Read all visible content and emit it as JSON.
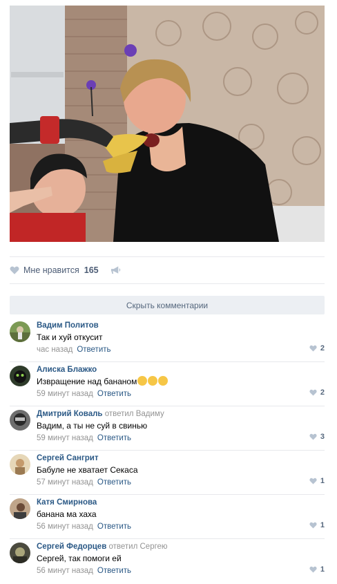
{
  "post": {
    "likes_label": "Мне нравится",
    "likes_count": "165"
  },
  "comments_toggle": "Скрыть комментарии",
  "comments": [
    {
      "author": "Вадим Политов",
      "reply_prefix": "",
      "reply_to": "",
      "text": "Так и хуй откусит",
      "time": "час назад",
      "reply_label": "Ответить",
      "likes": "2",
      "emojis": 0
    },
    {
      "author": "Алиска Блажко",
      "reply_prefix": "",
      "reply_to": "",
      "text": "Извращение над бананом",
      "time": "59 минут назад",
      "reply_label": "Ответить",
      "likes": "2",
      "emojis": 3
    },
    {
      "author": "Дмитрий Коваль",
      "reply_prefix": "ответил",
      "reply_to": "Вадиму",
      "text": "Вадим, а ты не суй в свинью",
      "time": "59 минут назад",
      "reply_label": "Ответить",
      "likes": "3",
      "emojis": 0
    },
    {
      "author": "Сергей Сангрит",
      "reply_prefix": "",
      "reply_to": "",
      "text": "Бабуле не хватает Секаса",
      "time": "57 минут назад",
      "reply_label": "Ответить",
      "likes": "1",
      "emojis": 0
    },
    {
      "author": "Катя Смирнова",
      "reply_prefix": "",
      "reply_to": "",
      "text": "банана ма хаха",
      "time": "56 минут назад",
      "reply_label": "Ответить",
      "likes": "1",
      "emojis": 0
    },
    {
      "author": "Сергей Федорцев",
      "reply_prefix": "ответил",
      "reply_to": "Сергею",
      "text": "Сергей, так помоги ей",
      "time": "56 минут назад",
      "reply_label": "Ответить",
      "likes": "1",
      "emojis": 0
    }
  ],
  "icons": {
    "like": "heart-icon",
    "share": "megaphone-icon",
    "comment_like": "small-heart-icon"
  },
  "colors": {
    "link": "#2a5885",
    "meta": "#939393",
    "like_text": "#4c5c75",
    "toggle_bg": "#eceff3"
  }
}
